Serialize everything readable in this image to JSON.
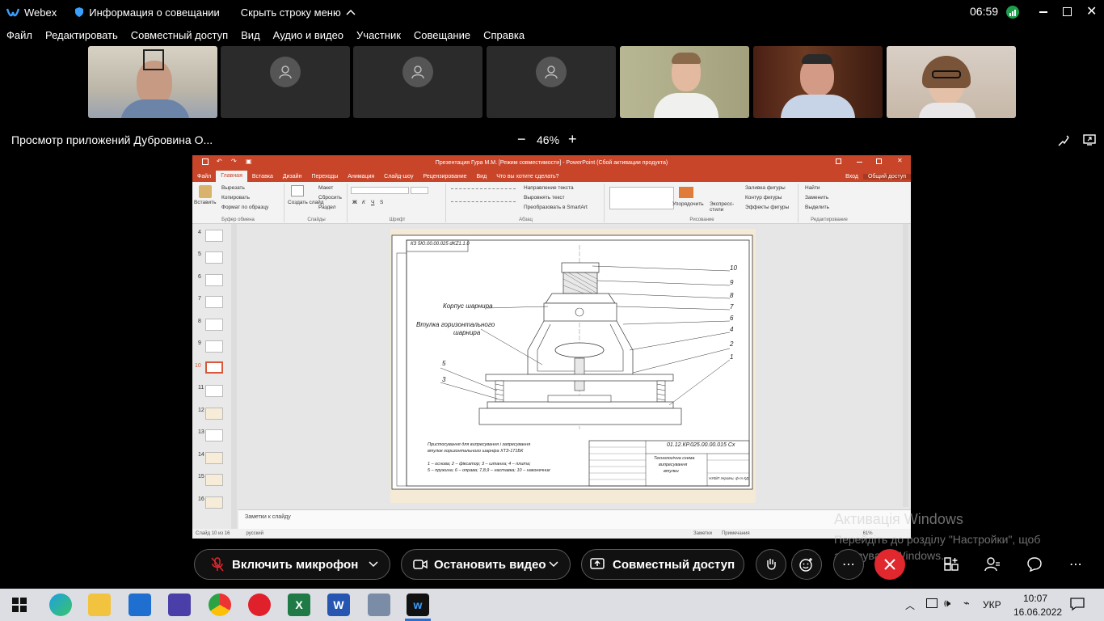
{
  "titlebar": {
    "app_name": "Webex",
    "meeting_info": "Информация о совещании",
    "hide_menu": "Скрыть строку меню",
    "time": "06:59"
  },
  "menubar": {
    "items": [
      "Файл",
      "Редактировать",
      "Совместный доступ",
      "Вид",
      "Аудио и видео",
      "Участник",
      "Совещание",
      "Справка"
    ]
  },
  "share": {
    "title": "Просмотр приложений Дубровина О...",
    "zoom_minus": "−",
    "zoom_level": "46%",
    "zoom_plus": "+"
  },
  "ppt": {
    "window_title": "Презентация Гура М.М. [Режим совместимости] - PowerPoint (Сбой активации продукта)",
    "tabs": [
      "Файл",
      "Главная",
      "Вставка",
      "Дизайн",
      "Переходы",
      "Анимация",
      "Слайд-шоу",
      "Рецензирование",
      "Вид",
      "Что вы хотите сделать?"
    ],
    "signin": "Вход",
    "share": "Общий доступ",
    "ribbon": {
      "paste": "Вставить",
      "cut": "Вырезать",
      "copy": "Копировать",
      "format_painter": "Формат по образцу",
      "clipboard": "Буфер обмена",
      "new_slide": "Создать слайд",
      "layout": "Макет",
      "reset": "Сбросить",
      "section": "Раздел",
      "slides": "Слайды",
      "font": "Шрифт",
      "text_direction": "Направление текста",
      "align_text": "Выровнять текст",
      "smartart": "Преобразовать в SmartArt",
      "paragraph": "Абзац",
      "arrange": "Упорядочить",
      "quick_styles": "Экспресс-стили",
      "shape_fill": "Заливка фигуры",
      "shape_outline": "Контур фигуры",
      "shape_effects": "Эффекты фигуры",
      "drawing": "Рисование",
      "find": "Найти",
      "replace": "Заменить",
      "select": "Выделить",
      "editing": "Редактирование"
    },
    "thumb_numbers": [
      "4",
      "5",
      "6",
      "7",
      "8",
      "9",
      "10",
      "11",
      "12",
      "13",
      "14",
      "15",
      "16"
    ],
    "slide": {
      "stamp_code": "КЗ 5Ю.00.00.025 dKZ1.1.0",
      "label_body": "Корпус шарнира",
      "label_bushing_1": "Втулка горизонтального",
      "label_bushing_2": "шарнира",
      "numbers_right": [
        "10",
        "9",
        "8",
        "7",
        "6",
        "4",
        "2",
        "1"
      ],
      "numbers_left": [
        "5",
        "3"
      ],
      "caption_1": "Пристосування для випресування і запресування",
      "caption_2": "втулок горизонтального шарніра ХТЗ-171БК",
      "caption_3": "1 – основа; 2 – фіксатор; 3 – штанга; 4 – плита;",
      "caption_4": "5 – пружина; 6 – оправа; 7,8,9 – наставка; 10 – наконечник",
      "doc_code": "01.12.КР.025.00.00.015 Сх",
      "doc_title_1": "Технологічна схема",
      "doc_title_2": "випресування",
      "doc_title_3": "втулки",
      "org": "НУБіП України, ф-т КД"
    },
    "notes_placeholder": "Заметки к слайду",
    "status_slide": "Слайд 10 из 16",
    "status_lang": "русский",
    "status_notes": "Заметки",
    "status_comments": "Примечания",
    "status_zoom": "61%"
  },
  "activation": {
    "line1": "Активація Windows",
    "line2": "Перейдіть до розділу \"Настройки\", щоб",
    "line3": "активувати Windows."
  },
  "controls": {
    "mic": "Включить микрофон",
    "video": "Остановить видео",
    "share": "Совместный доступ",
    "more": "⋯"
  },
  "taskbar": {
    "lang": "УКР",
    "time": "10:07",
    "date": "16.06.2022"
  },
  "colors": {
    "end_call": "#e0282e",
    "ppt_accent": "#c8452a",
    "selected_thumb": "#d9583a"
  }
}
